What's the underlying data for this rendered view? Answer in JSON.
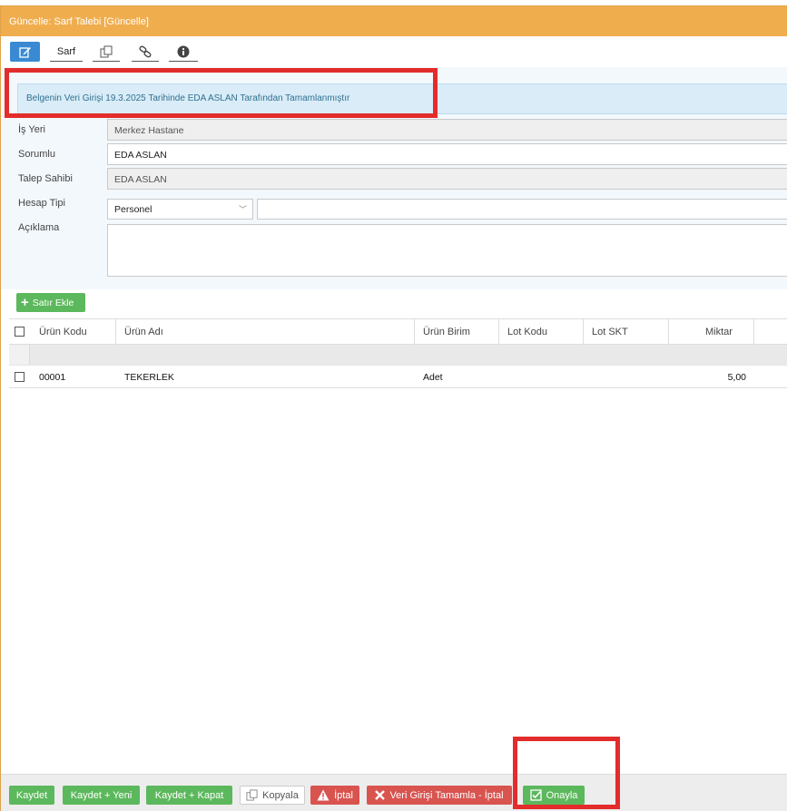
{
  "window": {
    "title": "Güncelle: Sarf Talebi [Güncelle]"
  },
  "toolbar": {
    "sarf_label": "Sarf"
  },
  "alert": {
    "text": "Belgenin Veri Girişi 19.3.2025 Tarihinde EDA ASLAN Tarafından Tamamlanmıştır"
  },
  "form": {
    "is_yeri": {
      "label": "İş Yeri",
      "value": "Merkez Hastane"
    },
    "sorumlu": {
      "label": "Sorumlu",
      "value": "EDA ASLAN"
    },
    "talep_sahibi": {
      "label": "Talep Sahibi",
      "value": "EDA ASLAN"
    },
    "hesap_tipi": {
      "label": "Hesap Tipi",
      "value": "Personel"
    },
    "aciklama": {
      "label": "Açıklama",
      "value": ""
    }
  },
  "grid": {
    "add_row_label": "Satır Ekle",
    "columns": [
      "Ürün Kodu",
      "Ürün Adı",
      "Ürün Birim",
      "Lot Kodu",
      "Lot SKT",
      "Miktar"
    ],
    "rows": [
      {
        "urun_kodu": "00001",
        "urun_adi": "TEKERLEK",
        "urun_birim": "Adet",
        "lot_kodu": "",
        "lot_skt": "",
        "miktar": "5,00"
      }
    ]
  },
  "footer": {
    "kaydet": "Kaydet",
    "kaydet_yeni": "Kaydet + Yeni",
    "kaydet_kapat": "Kaydet + Kapat",
    "kopyala": "Kopyala",
    "iptal": "İptal",
    "veri_girisi_iptal": "Veri Girişi Tamamla - İptal",
    "onayla": "Onayla"
  },
  "colors": {
    "title_bar": "#f0ad4e",
    "primary": "#3a8ad3",
    "success": "#5cb85c",
    "danger": "#d9534f",
    "highlight": "#e32c2c"
  }
}
